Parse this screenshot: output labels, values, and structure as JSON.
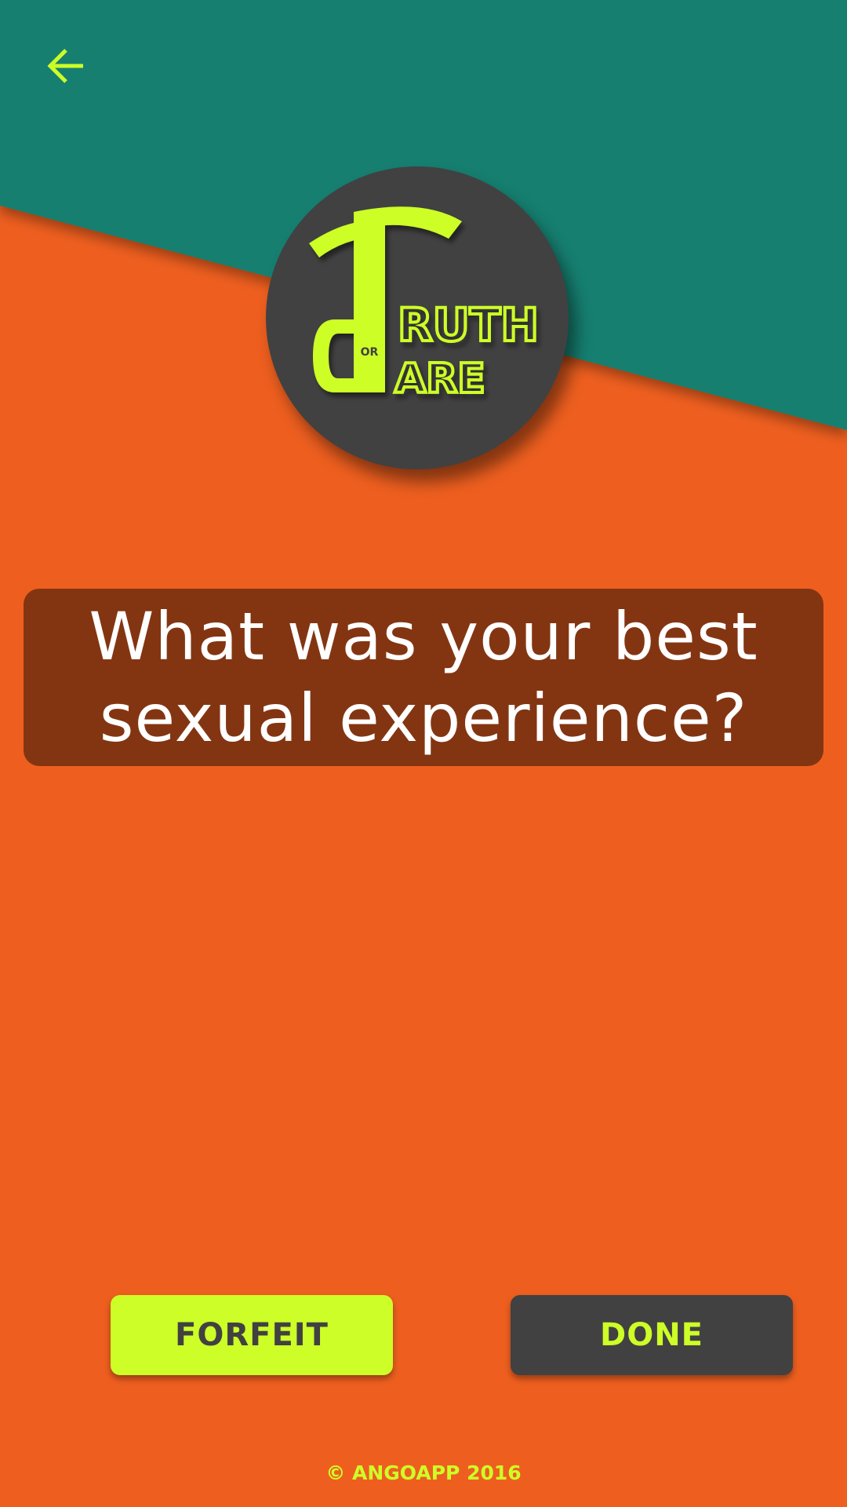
{
  "colors": {
    "background": "#ee5f1f",
    "header_band": "#127f6f",
    "accent": "#cdfe27",
    "dark": "#414141",
    "card": "#833512",
    "text": "#ffffff"
  },
  "header": {
    "back_icon": "arrow-left-icon"
  },
  "logo": {
    "word1": "RUTH",
    "connector": "OR",
    "word2": "ARE",
    "big_letter": "T"
  },
  "question": {
    "text": "What was your best sexual experience?"
  },
  "actions": {
    "forfeit_label": "FORFEIT",
    "done_label": "DONE"
  },
  "footer": {
    "copyright": "© ANGOAPP 2016"
  }
}
